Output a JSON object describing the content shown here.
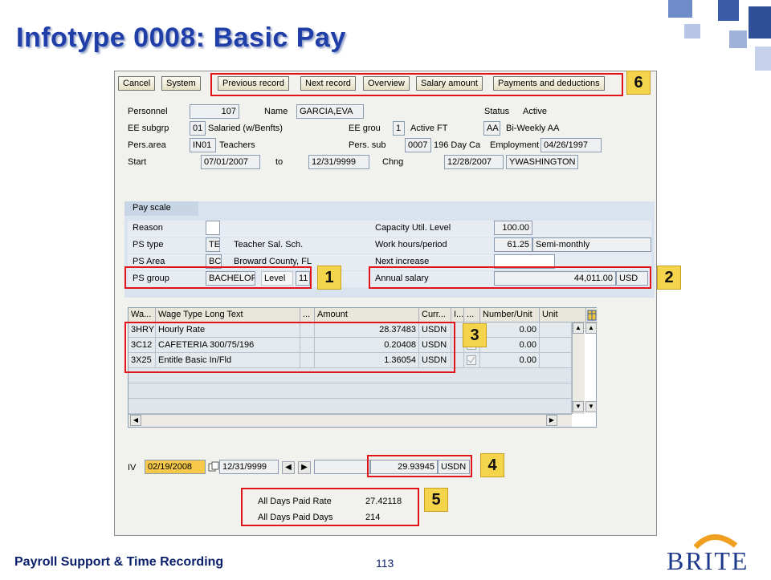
{
  "title": "Infotype 0008: Basic Pay",
  "toolbar": {
    "cancel": "Cancel",
    "system": "System",
    "previous_record": "Previous record",
    "next_record": "Next record",
    "overview": "Overview",
    "salary_amount": "Salary amount",
    "payments_deductions": "Payments and deductions"
  },
  "header": {
    "personnel_label": "Personnel",
    "personnel_value": "107",
    "name_label": "Name",
    "name_value": "GARCIA,EVA",
    "status_label": "Status",
    "status_value": "Active",
    "ee_subgrp_label": "EE subgrp",
    "ee_subgrp_code": "01",
    "ee_subgrp_text": "Salaried (w/Benfts)",
    "ee_grou_label": "EE grou",
    "ee_grou_code": "1",
    "ee_grou_text": "Active FT",
    "payroll_code": "AA",
    "payroll_text": "Bi-Weekly AA",
    "pers_area_label": "Pers.area",
    "pers_area_code": "IN01",
    "pers_area_text": "Teachers",
    "pers_sub_label": "Pers. sub",
    "pers_sub_code": "0007",
    "pers_sub_text": "196 Day Ca",
    "employment_label": "Employment",
    "employment_date": "04/26/1997",
    "start_label": "Start",
    "start_value": "07/01/2007",
    "to_label": "to",
    "to_value": "12/31/9999",
    "chng_label": "Chng",
    "chng_date": "12/28/2007",
    "chng_user": "YWASHINGTON"
  },
  "pay_scale": {
    "tab_label": "Pay scale",
    "reason_label": "Reason",
    "reason_value": "",
    "ps_type_label": "PS type",
    "ps_type_code": "TE",
    "ps_type_text": "Teacher Sal. Sch.",
    "ps_area_label": "PS Area",
    "ps_area_code": "BC",
    "ps_area_text": "Broward County, FL",
    "ps_group_label": "PS group",
    "ps_group_value": "BACHELOR",
    "level_label": "Level",
    "level_value": "11",
    "capacity_label": "Capacity Util. Level",
    "capacity_value": "100.00",
    "work_hours_label": "Work hours/period",
    "work_hours_value": "61.25",
    "work_hours_period": "Semi-monthly",
    "next_increase_label": "Next increase",
    "next_increase_value": "",
    "annual_salary_label": "Annual salary",
    "annual_salary_value": "44,011.00",
    "annual_salary_currency": "USD"
  },
  "wage_table": {
    "headers": [
      "Wa...",
      "Wage Type Long Text",
      "...",
      "Amount",
      "Curr...",
      "I...",
      "...",
      "Number/Unit",
      "Unit"
    ],
    "rows": [
      {
        "code": "3HRY",
        "text": "Hourly Rate",
        "amount": "28.37483",
        "currency": "USDN",
        "number": "0.00"
      },
      {
        "code": "3C12",
        "text": "CAFETERIA 300/75/196",
        "amount": "0.20408",
        "currency": "USDN",
        "number": "0.00"
      },
      {
        "code": "3X25",
        "text": "Entitle Basic In/Fld",
        "amount": "1.36054",
        "currency": "USDN",
        "number": "0.00"
      }
    ]
  },
  "valuation": {
    "label": "IV",
    "from_date": "02/19/2008",
    "to_date": "12/31/9999",
    "amount": "29.93945",
    "currency": "USDN"
  },
  "summary": {
    "rate_label": "All Days Paid Rate",
    "rate_value": "27.42118",
    "days_label": "All Days Paid Days",
    "days_value": "214"
  },
  "callouts": [
    "1",
    "2",
    "3",
    "4",
    "5",
    "6"
  ],
  "footer": {
    "course": "Payroll Support & Time Recording",
    "page": "113",
    "logo_text": "BRITE"
  },
  "colors": {
    "title": "#1f3ea8",
    "callout_border": "#e0141a",
    "callout_fill": "#f4d44a",
    "pay_scale_bg": "#d8e3ee"
  }
}
